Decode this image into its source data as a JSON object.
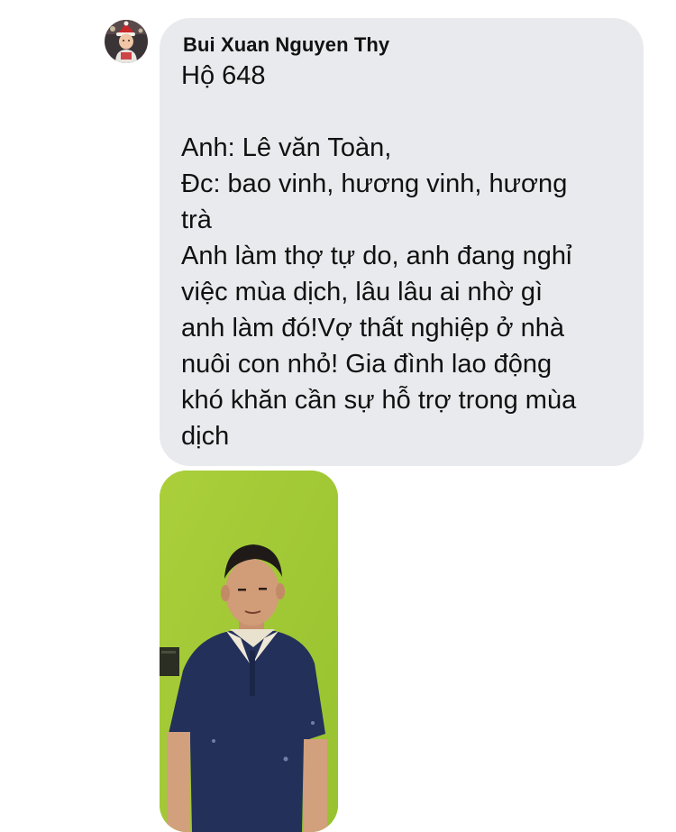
{
  "message": {
    "sender_name": "Bui Xuan Nguyen Thy",
    "lines": [
      "Hộ 648",
      "",
      "Anh: Lê văn Toàn,",
      "Đc: bao vinh, hương vinh, hương",
      "trà",
      "Anh làm thợ tự do, anh đang nghỉ",
      "việc mùa dịch, lâu lâu ai nhờ gì",
      "anh làm đó!Vợ thất nghiệp ở nhà",
      "nuôi con nhỏ! Gia đình lao động",
      "khó khăn cần sự hỗ trợ trong mùa",
      "dịch"
    ]
  },
  "colors": {
    "bubble_background": "#e9eaed",
    "text": "#111111",
    "photo_background": "#a3cc35",
    "shirt": "#22305a"
  },
  "icons": {
    "avatar": "profile-photo-child-santa-hat",
    "attachment": "photo-man-in-navy-polo-against-green-wall"
  }
}
